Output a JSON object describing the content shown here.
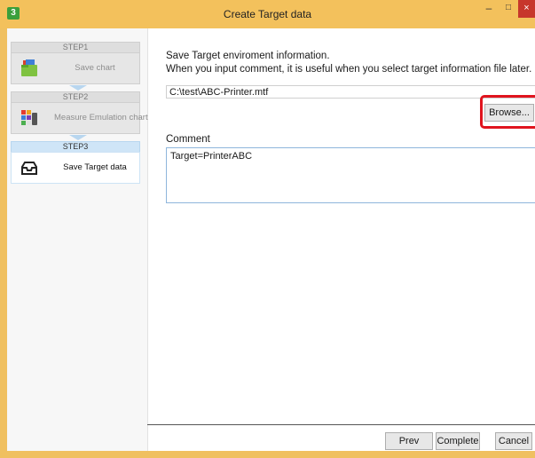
{
  "window": {
    "title": "Create Target data",
    "app_icon": "3",
    "min_symbol": "–",
    "max_symbol": "□",
    "close_symbol": "×"
  },
  "sidebar": {
    "steps": [
      {
        "step": "STEP1",
        "label": "Save chart",
        "icon": "folder-icon",
        "active": false
      },
      {
        "step": "STEP2",
        "label": "Measure Emulation chart",
        "icon": "color-chart-icon",
        "active": false
      },
      {
        "step": "STEP3",
        "label": "Save Target data",
        "icon": "save-tray-icon",
        "active": true
      }
    ]
  },
  "main": {
    "description_line1": "Save Target enviroment information.",
    "description_line2": "When you input comment, it is useful when you select target information file later.",
    "file_path": "C:\\test\\ABC-Printer.mtf",
    "browse_label": "Browse...",
    "comment_label": "Comment",
    "comment_value": "Target=PrinterABC"
  },
  "footer": {
    "prev_label": "Prev",
    "complete_label": "Complete",
    "cancel_label": "Cancel"
  },
  "colors": {
    "title_bar": "#f3c15c",
    "highlight": "#e0141e",
    "active_step": "#cfe5f7",
    "close_button": "#c7362b"
  }
}
